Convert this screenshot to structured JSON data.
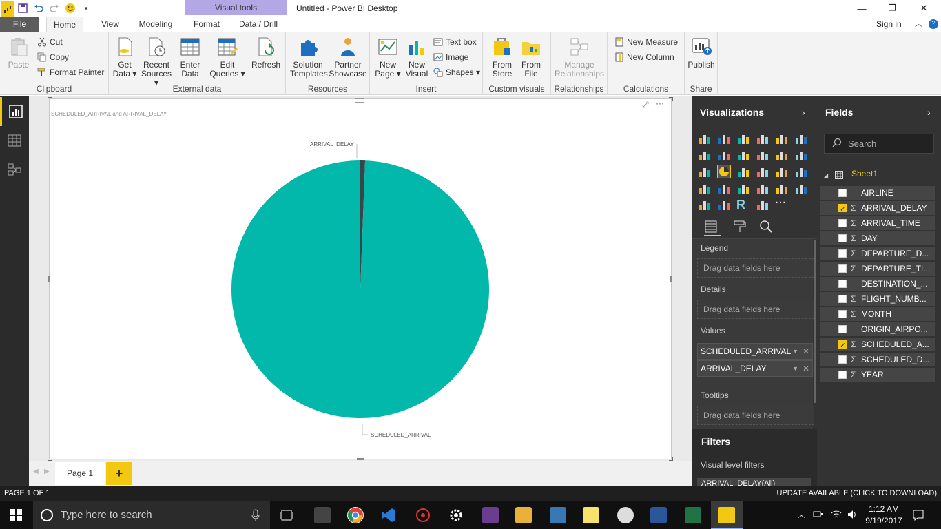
{
  "window": {
    "title": "Untitled - Power BI Desktop",
    "context_tab": "Visual tools",
    "controls": {
      "minimize": "—",
      "restore": "❐",
      "close": "✕"
    }
  },
  "tabs": {
    "file": "File",
    "items": [
      "Home",
      "View",
      "Modeling",
      "Format",
      "Data / Drill"
    ],
    "sign_in": "Sign in"
  },
  "ribbon": {
    "clipboard": {
      "paste": "Paste",
      "cut": "Cut",
      "copy": "Copy",
      "format_painter": "Format Painter",
      "label": "Clipboard"
    },
    "external_data": {
      "get_data": "Get",
      "get_data2": "Data ▾",
      "recent_sources": "Recent",
      "recent_sources2": "Sources ▾",
      "enter_data": "Enter",
      "enter_data2": "Data",
      "edit_queries": "Edit",
      "edit_queries2": "Queries ▾",
      "refresh": "Refresh",
      "label": "External data"
    },
    "resources": {
      "solution_templates": "Solution",
      "solution_templates2": "Templates",
      "partner_showcase": "Partner",
      "partner_showcase2": "Showcase",
      "label": "Resources"
    },
    "insert": {
      "new_page": "New",
      "new_page2": "Page ▾",
      "new_visual": "New",
      "new_visual2": "Visual",
      "text_box": "Text box",
      "image": "Image",
      "shapes": "Shapes ▾",
      "label": "Insert"
    },
    "custom_visuals": {
      "from_store": "From",
      "from_store2": "Store",
      "from_file": "From",
      "from_file2": "File",
      "label": "Custom visuals"
    },
    "relationships": {
      "manage": "Manage",
      "manage2": "Relationships",
      "label": "Relationships"
    },
    "calculations": {
      "new_measure": "New Measure",
      "new_column": "New Column",
      "label": "Calculations"
    },
    "share": {
      "publish": "Publish",
      "label": "Share"
    }
  },
  "visual": {
    "title": "SCHEDULED_ARRIVAL and ARRIVAL_DELAY",
    "label_top": "ARRIVAL_DELAY",
    "label_bottom": "SCHEDULED_ARRIVAL",
    "more": "···"
  },
  "chart_data": {
    "type": "pie",
    "title": "SCHEDULED_ARRIVAL and ARRIVAL_DELAY",
    "slices": [
      {
        "name": "SCHEDULED_ARRIVAL",
        "fraction": 0.994,
        "color": "#01b8aa"
      },
      {
        "name": "ARRIVAL_DELAY",
        "fraction": 0.006,
        "color": "#374649"
      }
    ]
  },
  "pages": {
    "tab": "Page 1",
    "add": "+"
  },
  "viz_pane": {
    "header": "Visualizations",
    "chevron": "›",
    "wells": {
      "legend": "Legend",
      "details": "Details",
      "values": "Values",
      "tooltips": "Tooltips",
      "drop_hint": "Drag data fields here",
      "value_items": [
        "SCHEDULED_ARRIVAL",
        "ARRIVAL_DELAY"
      ]
    },
    "filters": {
      "header": "Filters",
      "visual_level": "Visual level filters",
      "item": "ARRIVAL_DELAY(All)"
    }
  },
  "fields_pane": {
    "header": "Fields",
    "chevron": "›",
    "search_placeholder": "Search",
    "table": "Sheet1",
    "fields": [
      {
        "name": "AIRLINE",
        "sigma": false,
        "checked": false
      },
      {
        "name": "ARRIVAL_DELAY",
        "sigma": true,
        "checked": true
      },
      {
        "name": "ARRIVAL_TIME",
        "sigma": true,
        "checked": false
      },
      {
        "name": "DAY",
        "sigma": true,
        "checked": false
      },
      {
        "name": "DEPARTURE_D...",
        "sigma": true,
        "checked": false
      },
      {
        "name": "DEPARTURE_TI...",
        "sigma": true,
        "checked": false
      },
      {
        "name": "DESTINATION_...",
        "sigma": false,
        "checked": false
      },
      {
        "name": "FLIGHT_NUMB...",
        "sigma": true,
        "checked": false
      },
      {
        "name": "MONTH",
        "sigma": true,
        "checked": false
      },
      {
        "name": "ORIGIN_AIRPO...",
        "sigma": false,
        "checked": false
      },
      {
        "name": "SCHEDULED_A...",
        "sigma": true,
        "checked": true
      },
      {
        "name": "SCHEDULED_D...",
        "sigma": true,
        "checked": false
      },
      {
        "name": "YEAR",
        "sigma": true,
        "checked": false
      }
    ]
  },
  "status": {
    "left": "PAGE 1 OF 1",
    "right": "UPDATE AVAILABLE (CLICK TO DOWNLOAD)"
  },
  "taskbar": {
    "search_placeholder": "Type here to search",
    "time": "1:12 AM",
    "date": "9/19/2017"
  }
}
